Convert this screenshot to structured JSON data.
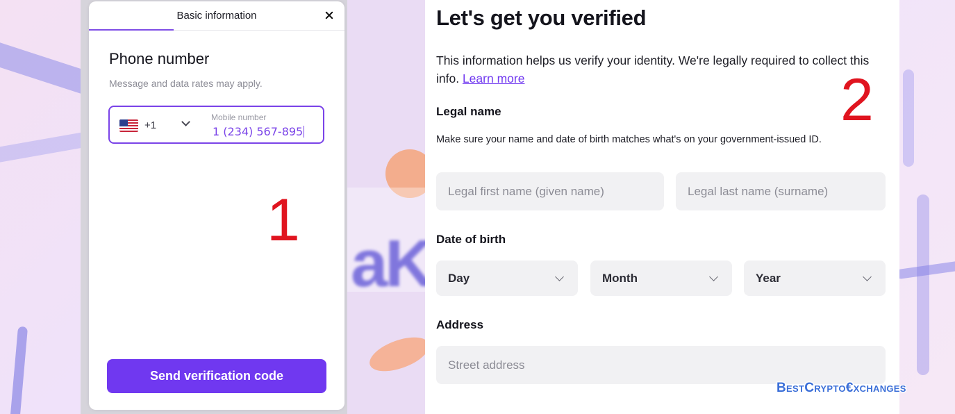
{
  "left_modal": {
    "header_title": "Basic information",
    "heading": "Phone number",
    "subtext": "Message and data rates may apply.",
    "phone_field": {
      "country_icon": "us-flag-icon",
      "dial_code": "+1",
      "label": "Mobile number",
      "value": "1 (234) 567-895"
    },
    "send_button": "Send verification code",
    "step_number": "1"
  },
  "right_form": {
    "title": "Let's get you verified",
    "info_text": "This information helps us verify your identity. We're legally required to collect this info.",
    "learn_more": "Learn more",
    "step_number": "2",
    "legal_name": {
      "label": "Legal name",
      "note": "Make sure your name and date of birth matches what's on your government-issued ID.",
      "first_placeholder": "Legal first name (given name)",
      "last_placeholder": "Legal last name (surname)"
    },
    "dob": {
      "label": "Date of birth",
      "day": "Day",
      "month": "Month",
      "year": "Year"
    },
    "address": {
      "label": "Address",
      "street_placeholder": "Street address"
    }
  },
  "watermark": "BestCrypto€xchanges",
  "colors": {
    "accent": "#7038f0",
    "step_number": "#e0141f",
    "input_bg": "#f1f1f3"
  }
}
